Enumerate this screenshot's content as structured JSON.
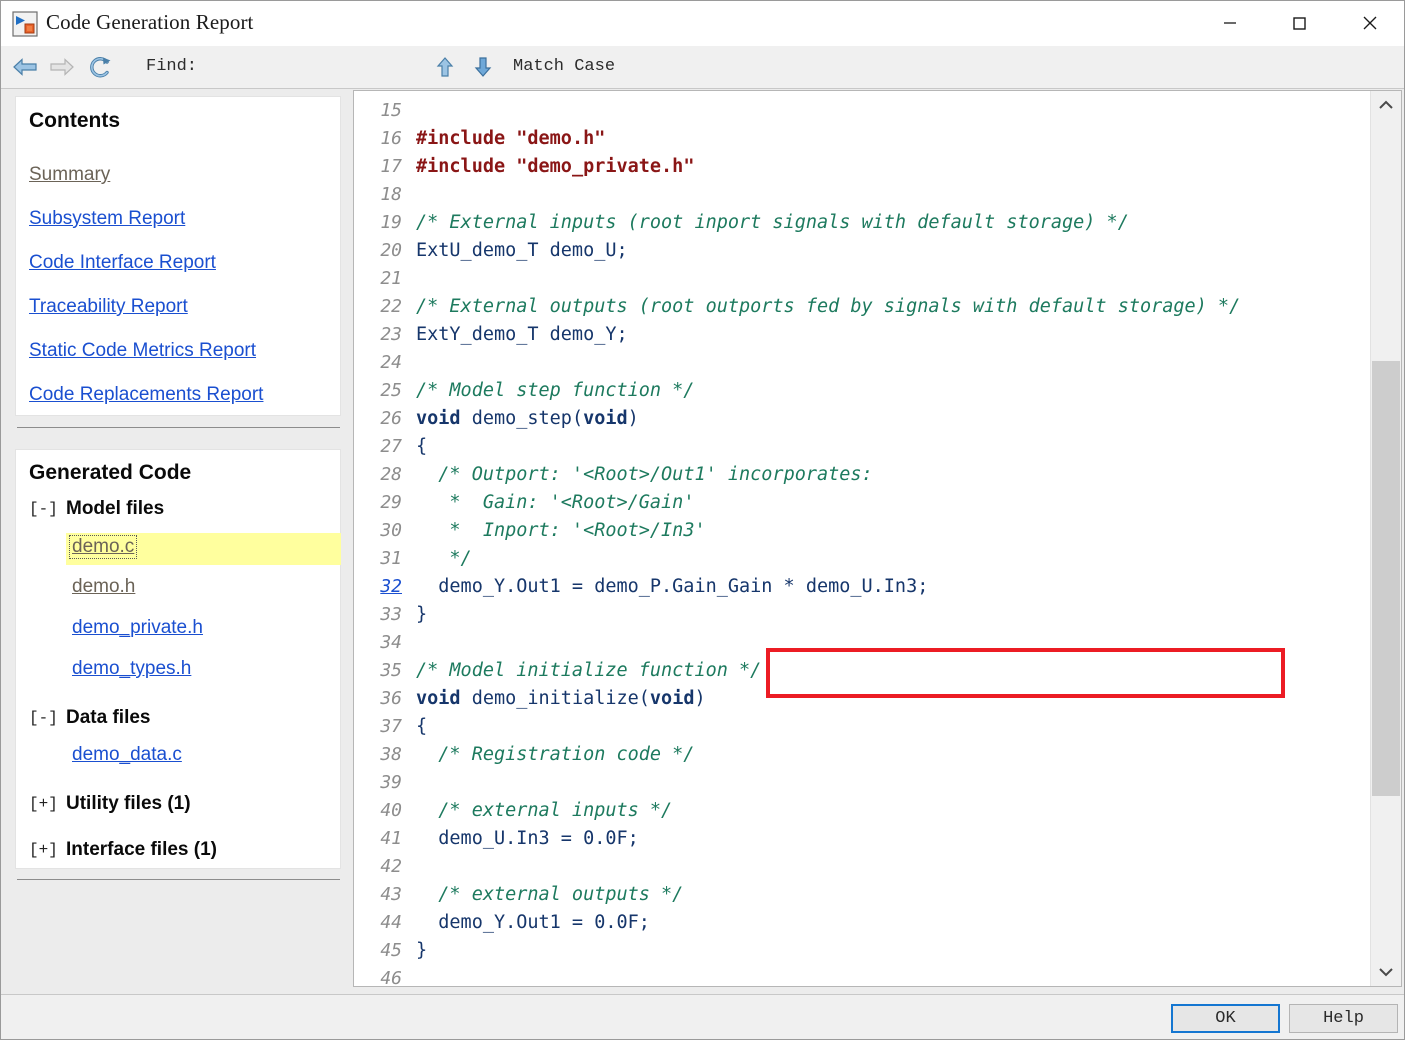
{
  "window": {
    "title": "Code Generation Report",
    "app_icon": "simulink-report-icon",
    "controls": {
      "minimize": "minimize-icon",
      "maximize": "maximize-icon",
      "close": "close-icon"
    }
  },
  "toolbar": {
    "back_icon": "arrow-left-icon",
    "forward_icon": "arrow-right-icon",
    "reload_icon": "reload-icon",
    "find_label": "Find:",
    "find_value": "",
    "find_placeholder": "",
    "find_up_icon": "arrow-up-icon",
    "find_down_icon": "arrow-down-icon",
    "match_case_label": "Match Case"
  },
  "sidebar": {
    "contents": {
      "title": "Contents",
      "links": [
        {
          "label": "Summary",
          "state": "visited"
        },
        {
          "label": "Subsystem Report",
          "state": "link"
        },
        {
          "label": "Code Interface Report",
          "state": "link"
        },
        {
          "label": "Traceability Report",
          "state": "link"
        },
        {
          "label": "Static Code Metrics Report",
          "state": "link"
        },
        {
          "label": "Code Replacements Report",
          "state": "link"
        }
      ]
    },
    "generated_code": {
      "title": "Generated Code",
      "groups": [
        {
          "toggle": "[-]",
          "label": "Model files",
          "expanded": true,
          "files": [
            {
              "label": "demo.c",
              "state": "visited",
              "selected": true
            },
            {
              "label": "demo.h",
              "state": "visited",
              "selected": false
            },
            {
              "label": "demo_private.h",
              "state": "link",
              "selected": false
            },
            {
              "label": "demo_types.h",
              "state": "link",
              "selected": false
            }
          ]
        },
        {
          "toggle": "[-]",
          "label": "Data files",
          "expanded": true,
          "files": [
            {
              "label": "demo_data.c",
              "state": "link",
              "selected": false
            }
          ]
        },
        {
          "toggle": "[+]",
          "label": "Utility files (1)",
          "expanded": false,
          "files": []
        },
        {
          "toggle": "[+]",
          "label": "Interface files (1)",
          "expanded": false,
          "files": []
        }
      ]
    }
  },
  "code_view": {
    "file": "demo.c",
    "first_visible_line": 15,
    "last_visible_line": 46,
    "highlighted_line": 32,
    "highlight_color": "#ec1c24",
    "lines": [
      {
        "n": "15",
        "segs": []
      },
      {
        "n": "16",
        "segs": [
          {
            "t": "#include ",
            "k": "pp"
          },
          {
            "t": "\"demo.h\"",
            "k": "str"
          }
        ]
      },
      {
        "n": "17",
        "segs": [
          {
            "t": "#include ",
            "k": "pp"
          },
          {
            "t": "\"demo_private.h\"",
            "k": "str"
          }
        ]
      },
      {
        "n": "18",
        "segs": []
      },
      {
        "n": "19",
        "segs": [
          {
            "t": "/* External inputs (root inport signals with default storage) */",
            "k": "cmt"
          }
        ]
      },
      {
        "n": "20",
        "segs": [
          {
            "t": "ExtU_demo_T demo_U;",
            "k": "code"
          }
        ]
      },
      {
        "n": "21",
        "segs": []
      },
      {
        "n": "22",
        "segs": [
          {
            "t": "/* External outputs (root outports fed by signals with default storage) */",
            "k": "cmt"
          }
        ]
      },
      {
        "n": "23",
        "segs": [
          {
            "t": "ExtY_demo_T demo_Y;",
            "k": "code"
          }
        ]
      },
      {
        "n": "24",
        "segs": []
      },
      {
        "n": "25",
        "segs": [
          {
            "t": "/* Model step function */",
            "k": "cmt"
          }
        ]
      },
      {
        "n": "26",
        "segs": [
          {
            "t": "void",
            "k": "kw"
          },
          {
            "t": " demo_step(",
            "k": "code"
          },
          {
            "t": "void",
            "k": "kw"
          },
          {
            "t": ")",
            "k": "code"
          }
        ]
      },
      {
        "n": "27",
        "segs": [
          {
            "t": "{",
            "k": "code"
          }
        ]
      },
      {
        "n": "28",
        "segs": [
          {
            "t": "  /* Outport: '",
            "k": "cmt"
          },
          {
            "t": "<Root>/Out1",
            "k": "cmtlink"
          },
          {
            "t": "' incorporates:",
            "k": "cmt"
          }
        ]
      },
      {
        "n": "29",
        "segs": [
          {
            "t": "   *  Gain: '",
            "k": "cmt"
          },
          {
            "t": "<Root>/Gain",
            "k": "cmtlink"
          },
          {
            "t": "'",
            "k": "cmt"
          }
        ]
      },
      {
        "n": "30",
        "segs": [
          {
            "t": "   *  Inport: '",
            "k": "cmt"
          },
          {
            "t": "<Root>/In3",
            "k": "cmtlink"
          },
          {
            "t": "'",
            "k": "cmt"
          }
        ]
      },
      {
        "n": "31",
        "segs": [
          {
            "t": "   */",
            "k": "cmt"
          }
        ]
      },
      {
        "n": "32",
        "nlink": true,
        "segs": [
          {
            "t": "  demo_Y.Out1 = demo_P.Gain_Gain * demo_U.In3;",
            "k": "code"
          }
        ]
      },
      {
        "n": "33",
        "segs": [
          {
            "t": "}",
            "k": "code"
          }
        ]
      },
      {
        "n": "34",
        "segs": []
      },
      {
        "n": "35",
        "segs": [
          {
            "t": "/* Model initialize function */",
            "k": "cmt"
          }
        ]
      },
      {
        "n": "36",
        "segs": [
          {
            "t": "void",
            "k": "kw"
          },
          {
            "t": " demo_initialize(",
            "k": "code"
          },
          {
            "t": "void",
            "k": "kw"
          },
          {
            "t": ")",
            "k": "code"
          }
        ]
      },
      {
        "n": "37",
        "segs": [
          {
            "t": "{",
            "k": "code"
          }
        ]
      },
      {
        "n": "38",
        "segs": [
          {
            "t": "  /* Registration code */",
            "k": "cmt"
          }
        ]
      },
      {
        "n": "39",
        "segs": []
      },
      {
        "n": "40",
        "segs": [
          {
            "t": "  /* external inputs */",
            "k": "cmt"
          }
        ]
      },
      {
        "n": "41",
        "segs": [
          {
            "t": "  demo_U.In3 = 0.0F;",
            "k": "code"
          }
        ]
      },
      {
        "n": "42",
        "segs": []
      },
      {
        "n": "43",
        "segs": [
          {
            "t": "  /* external outputs */",
            "k": "cmt"
          }
        ]
      },
      {
        "n": "44",
        "segs": [
          {
            "t": "  demo_Y.Out1 = 0.0F;",
            "k": "code"
          }
        ]
      },
      {
        "n": "45",
        "segs": [
          {
            "t": "}",
            "k": "code"
          }
        ]
      },
      {
        "n": "46",
        "segs": []
      }
    ],
    "scrollbar": {
      "up_icon": "chevron-up-icon",
      "down_icon": "chevron-down-icon"
    }
  },
  "footer": {
    "ok_label": "OK",
    "help_label": "Help"
  }
}
